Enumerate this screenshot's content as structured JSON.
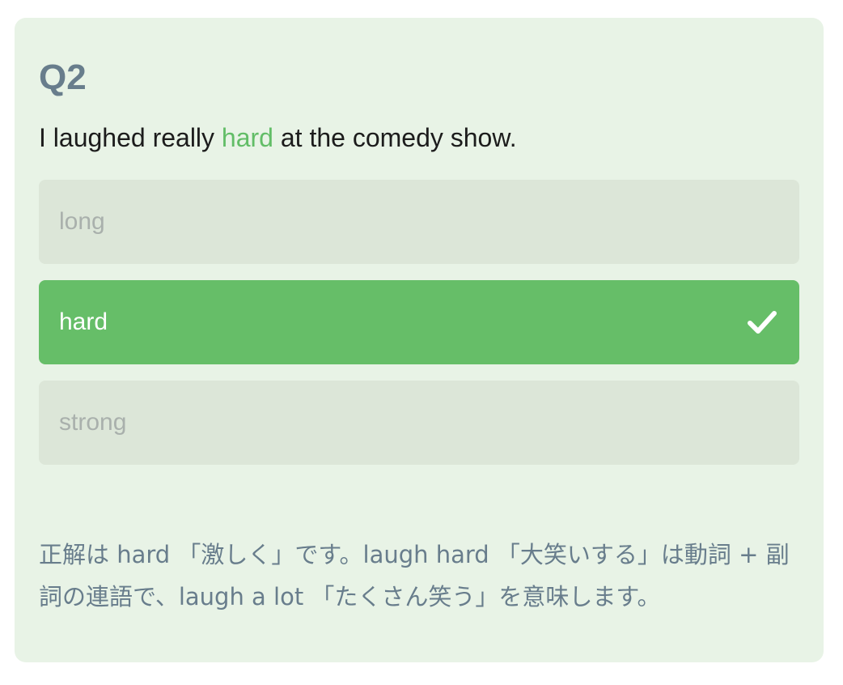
{
  "question": {
    "number": "Q2",
    "before": "I laughed really ",
    "highlight": "hard",
    "after": " at the comedy show."
  },
  "options": [
    {
      "label": "long",
      "state": "dimmed"
    },
    {
      "label": "hard",
      "state": "correct",
      "icon": "checkmark-icon"
    },
    {
      "label": "strong",
      "state": "dimmed"
    }
  ],
  "explanation": "正解は hard 「激しく」です。laugh hard 「大笑いする」は動詞 + 副詞の連語で、laugh a lot 「たくさん笑う」を意味します。",
  "colors": {
    "card_background": "#e8f3e6",
    "accent_green": "#66be68",
    "dimmed_option": "#dce6d8",
    "label_gray": "#687d8c"
  }
}
